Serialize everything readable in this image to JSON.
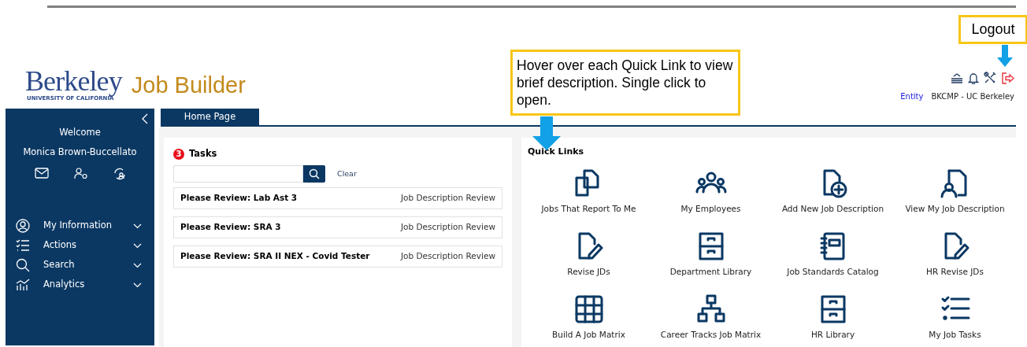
{
  "header": {
    "logo_name": "Berkeley",
    "logo_sub": "UNIVERSITY OF CALIFORNIA",
    "app_title": "Job Builder",
    "entity_label": "Entity",
    "entity_value": "BKCMP - UC Berkeley"
  },
  "callouts": [
    {
      "text": "Logout"
    },
    {
      "text": "Hover over each Quick Link to view brief description. Single click to open."
    }
  ],
  "sidebar": {
    "welcome": "Welcome",
    "user": "Monica Brown-Buccellato",
    "items": [
      {
        "label": "My Information"
      },
      {
        "label": "Actions"
      },
      {
        "label": "Search"
      },
      {
        "label": "Analytics"
      }
    ]
  },
  "tabs": [
    {
      "label": "Home Page",
      "selected": true
    }
  ],
  "tasks": {
    "count": "3",
    "title": "Tasks",
    "clear": "Clear",
    "rows": [
      {
        "title": "Please Review: Lab Ast 3",
        "type": "Job Description Review"
      },
      {
        "title": "Please Review: SRA 3",
        "type": "Job Description Review"
      },
      {
        "title": "Please Review: SRA II NEX - Covid Tester",
        "type": "Job Description Review"
      }
    ]
  },
  "quick_links": {
    "title": "Quick Links",
    "items": [
      {
        "label": "Jobs That Report To Me"
      },
      {
        "label": "My Employees"
      },
      {
        "label": "Add New Job Description"
      },
      {
        "label": "View My Job Description"
      },
      {
        "label": "Revise JDs"
      },
      {
        "label": "Department Library"
      },
      {
        "label": "Job Standards Catalog"
      },
      {
        "label": "HR Revise JDs"
      },
      {
        "label": "Build A Job Matrix"
      },
      {
        "label": "Career Tracks Job Matrix"
      },
      {
        "label": "HR Library"
      },
      {
        "label": "My Job Tasks"
      }
    ]
  }
}
